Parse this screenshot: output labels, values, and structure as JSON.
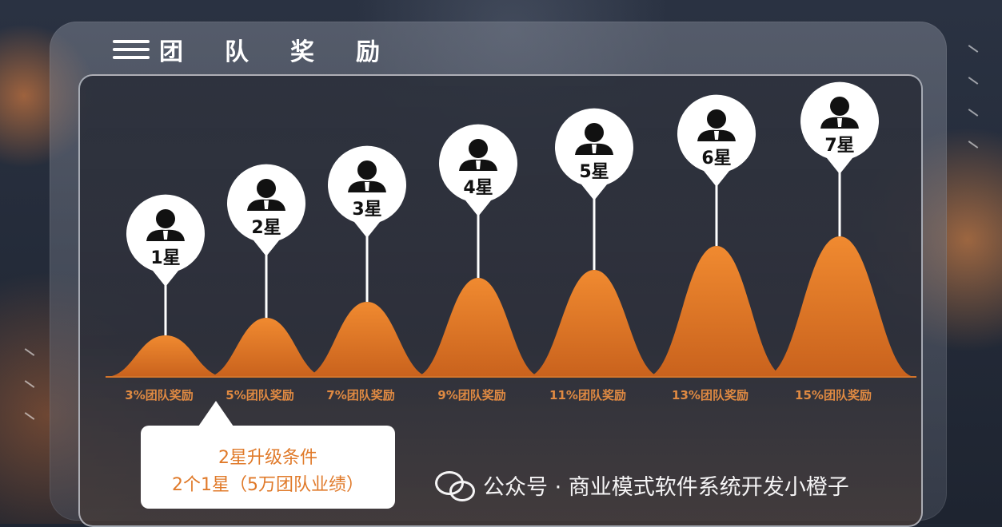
{
  "header": {
    "title": "团队奖励"
  },
  "levels": [
    {
      "star": "1星",
      "reward": "3%团队奖励",
      "height": 1
    },
    {
      "star": "2星",
      "reward": "5%团队奖励",
      "height": 2
    },
    {
      "star": "3星",
      "reward": "7%团队奖励",
      "height": 3
    },
    {
      "star": "4星",
      "reward": "9%团队奖励",
      "height": 4
    },
    {
      "star": "5星",
      "reward": "11%团队奖励",
      "height": 5
    },
    {
      "star": "6星",
      "reward": "13%团队奖励",
      "height": 6
    },
    {
      "star": "7星",
      "reward": "15%团队奖励",
      "height": 7
    }
  ],
  "callout": {
    "line1": "2星升级条件",
    "line2": "2个1星（5万团队业绩）"
  },
  "watermark": {
    "text": "公众号 · 商业模式软件系统开发小橙子"
  },
  "colors": {
    "accent": "#e8822e",
    "mountain": "#e07a2a",
    "label": "#e08a42"
  }
}
